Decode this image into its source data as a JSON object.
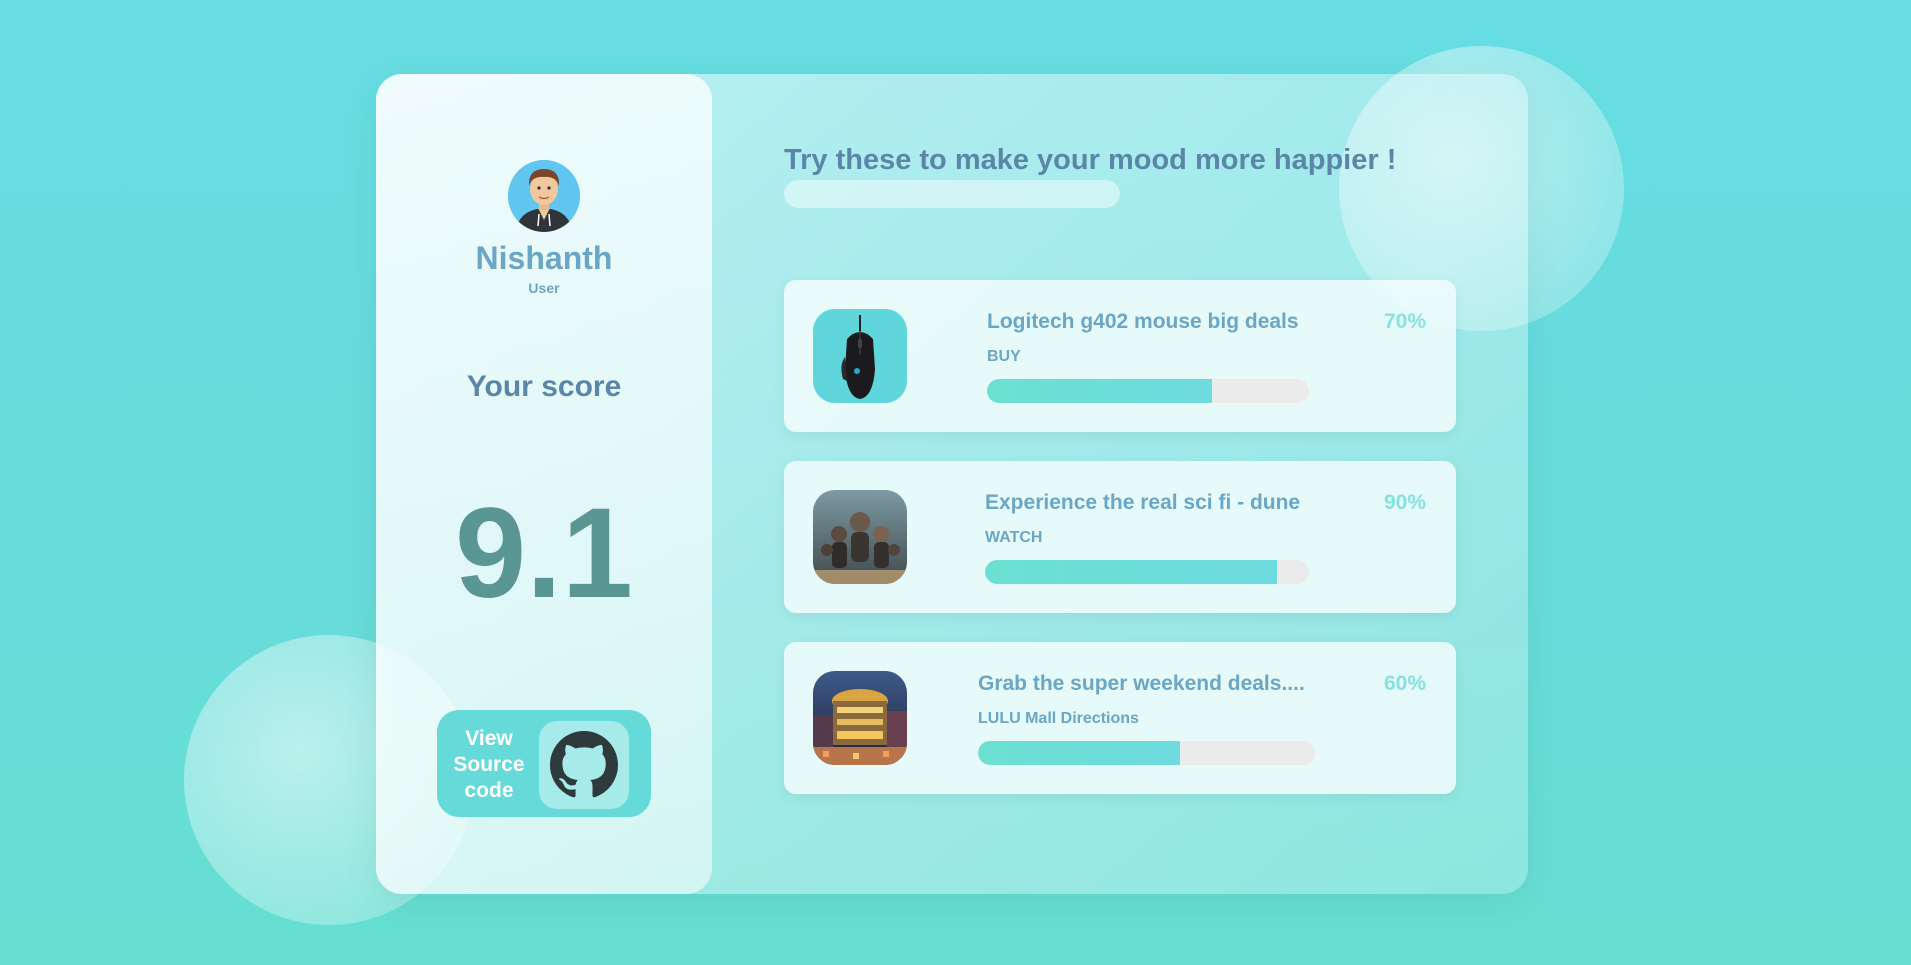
{
  "profile": {
    "name": "Nishanth",
    "role": "User",
    "score_label": "Your score",
    "score": "9.1",
    "source_button": {
      "line1": "View",
      "line2": "Source",
      "line3": "code",
      "icon": "github-icon"
    }
  },
  "main": {
    "heading": "Try these to make your mood more happier !",
    "recommendations": [
      {
        "title": "Logitech g402 mouse big deals",
        "action": "BUY",
        "percent_label": "70%",
        "progress": 0.7,
        "thumb_icon": "mouse-thumbnail"
      },
      {
        "title": "Experience the real sci fi - dune",
        "action": "WATCH",
        "percent_label": "90%",
        "progress": 0.9,
        "thumb_icon": "dune-poster-thumbnail"
      },
      {
        "title": "Grab the super weekend deals....",
        "action": "LULU Mall Directions",
        "percent_label": "60%",
        "progress": 0.6,
        "thumb_icon": "mall-thumbnail"
      }
    ]
  },
  "colors": {
    "accent": "#66dad8",
    "title_text": "#6aa6c5",
    "heading_text": "#5b86a8",
    "score_text": "#5a9693",
    "percent_text": "#86e1e3"
  }
}
